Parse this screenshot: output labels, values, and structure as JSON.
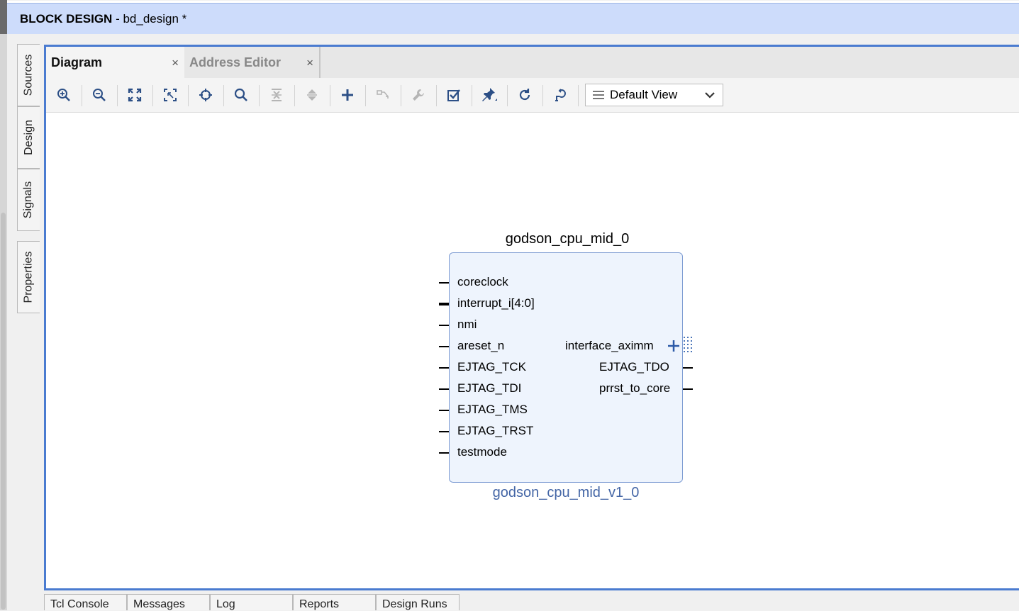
{
  "header": {
    "title_strong": "BLOCK DESIGN",
    "title_rest": " - bd_design *"
  },
  "side_tabs": [
    "Sources",
    "Design",
    "Signals",
    "Properties"
  ],
  "tabs": [
    {
      "label": "Diagram",
      "close": "×"
    },
    {
      "label": "Address Editor",
      "close": "×"
    }
  ],
  "toolbar": {
    "icons": [
      "zoom-in-icon",
      "zoom-out-icon",
      "zoom-fit-icon",
      "zoom-area-icon",
      "center-icon",
      "search-icon",
      "collapse-all-icon",
      "expand-all-icon",
      "add-ip-icon",
      "make-connection-icon",
      "properties-wrench-icon",
      "validate-design-icon",
      "autoconnect-pin-icon",
      "regenerate-layout-icon",
      "optimize-routing-icon"
    ],
    "view_select": "Default View"
  },
  "block": {
    "instance_name": "godson_cpu_mid_0",
    "ip_name": "godson_cpu_mid_v1_0",
    "left_ports": [
      "coreclock",
      "interrupt_i[4:0]",
      "nmi",
      "areset_n",
      "EJTAG_TCK",
      "EJTAG_TDI",
      "EJTAG_TMS",
      "EJTAG_TRST",
      "testmode"
    ],
    "right_ports": [
      "interface_aximm",
      "EJTAG_TDO",
      "prrst_to_core"
    ]
  },
  "bottom_tabs": [
    "Tcl Console",
    "Messages",
    "Log",
    "Reports",
    "Design Runs"
  ],
  "colors": {
    "accent": "#4a7bd0",
    "header_bg": "#cddcfb",
    "block_fill": "#eef4fd",
    "ip_label": "#4466a6"
  }
}
